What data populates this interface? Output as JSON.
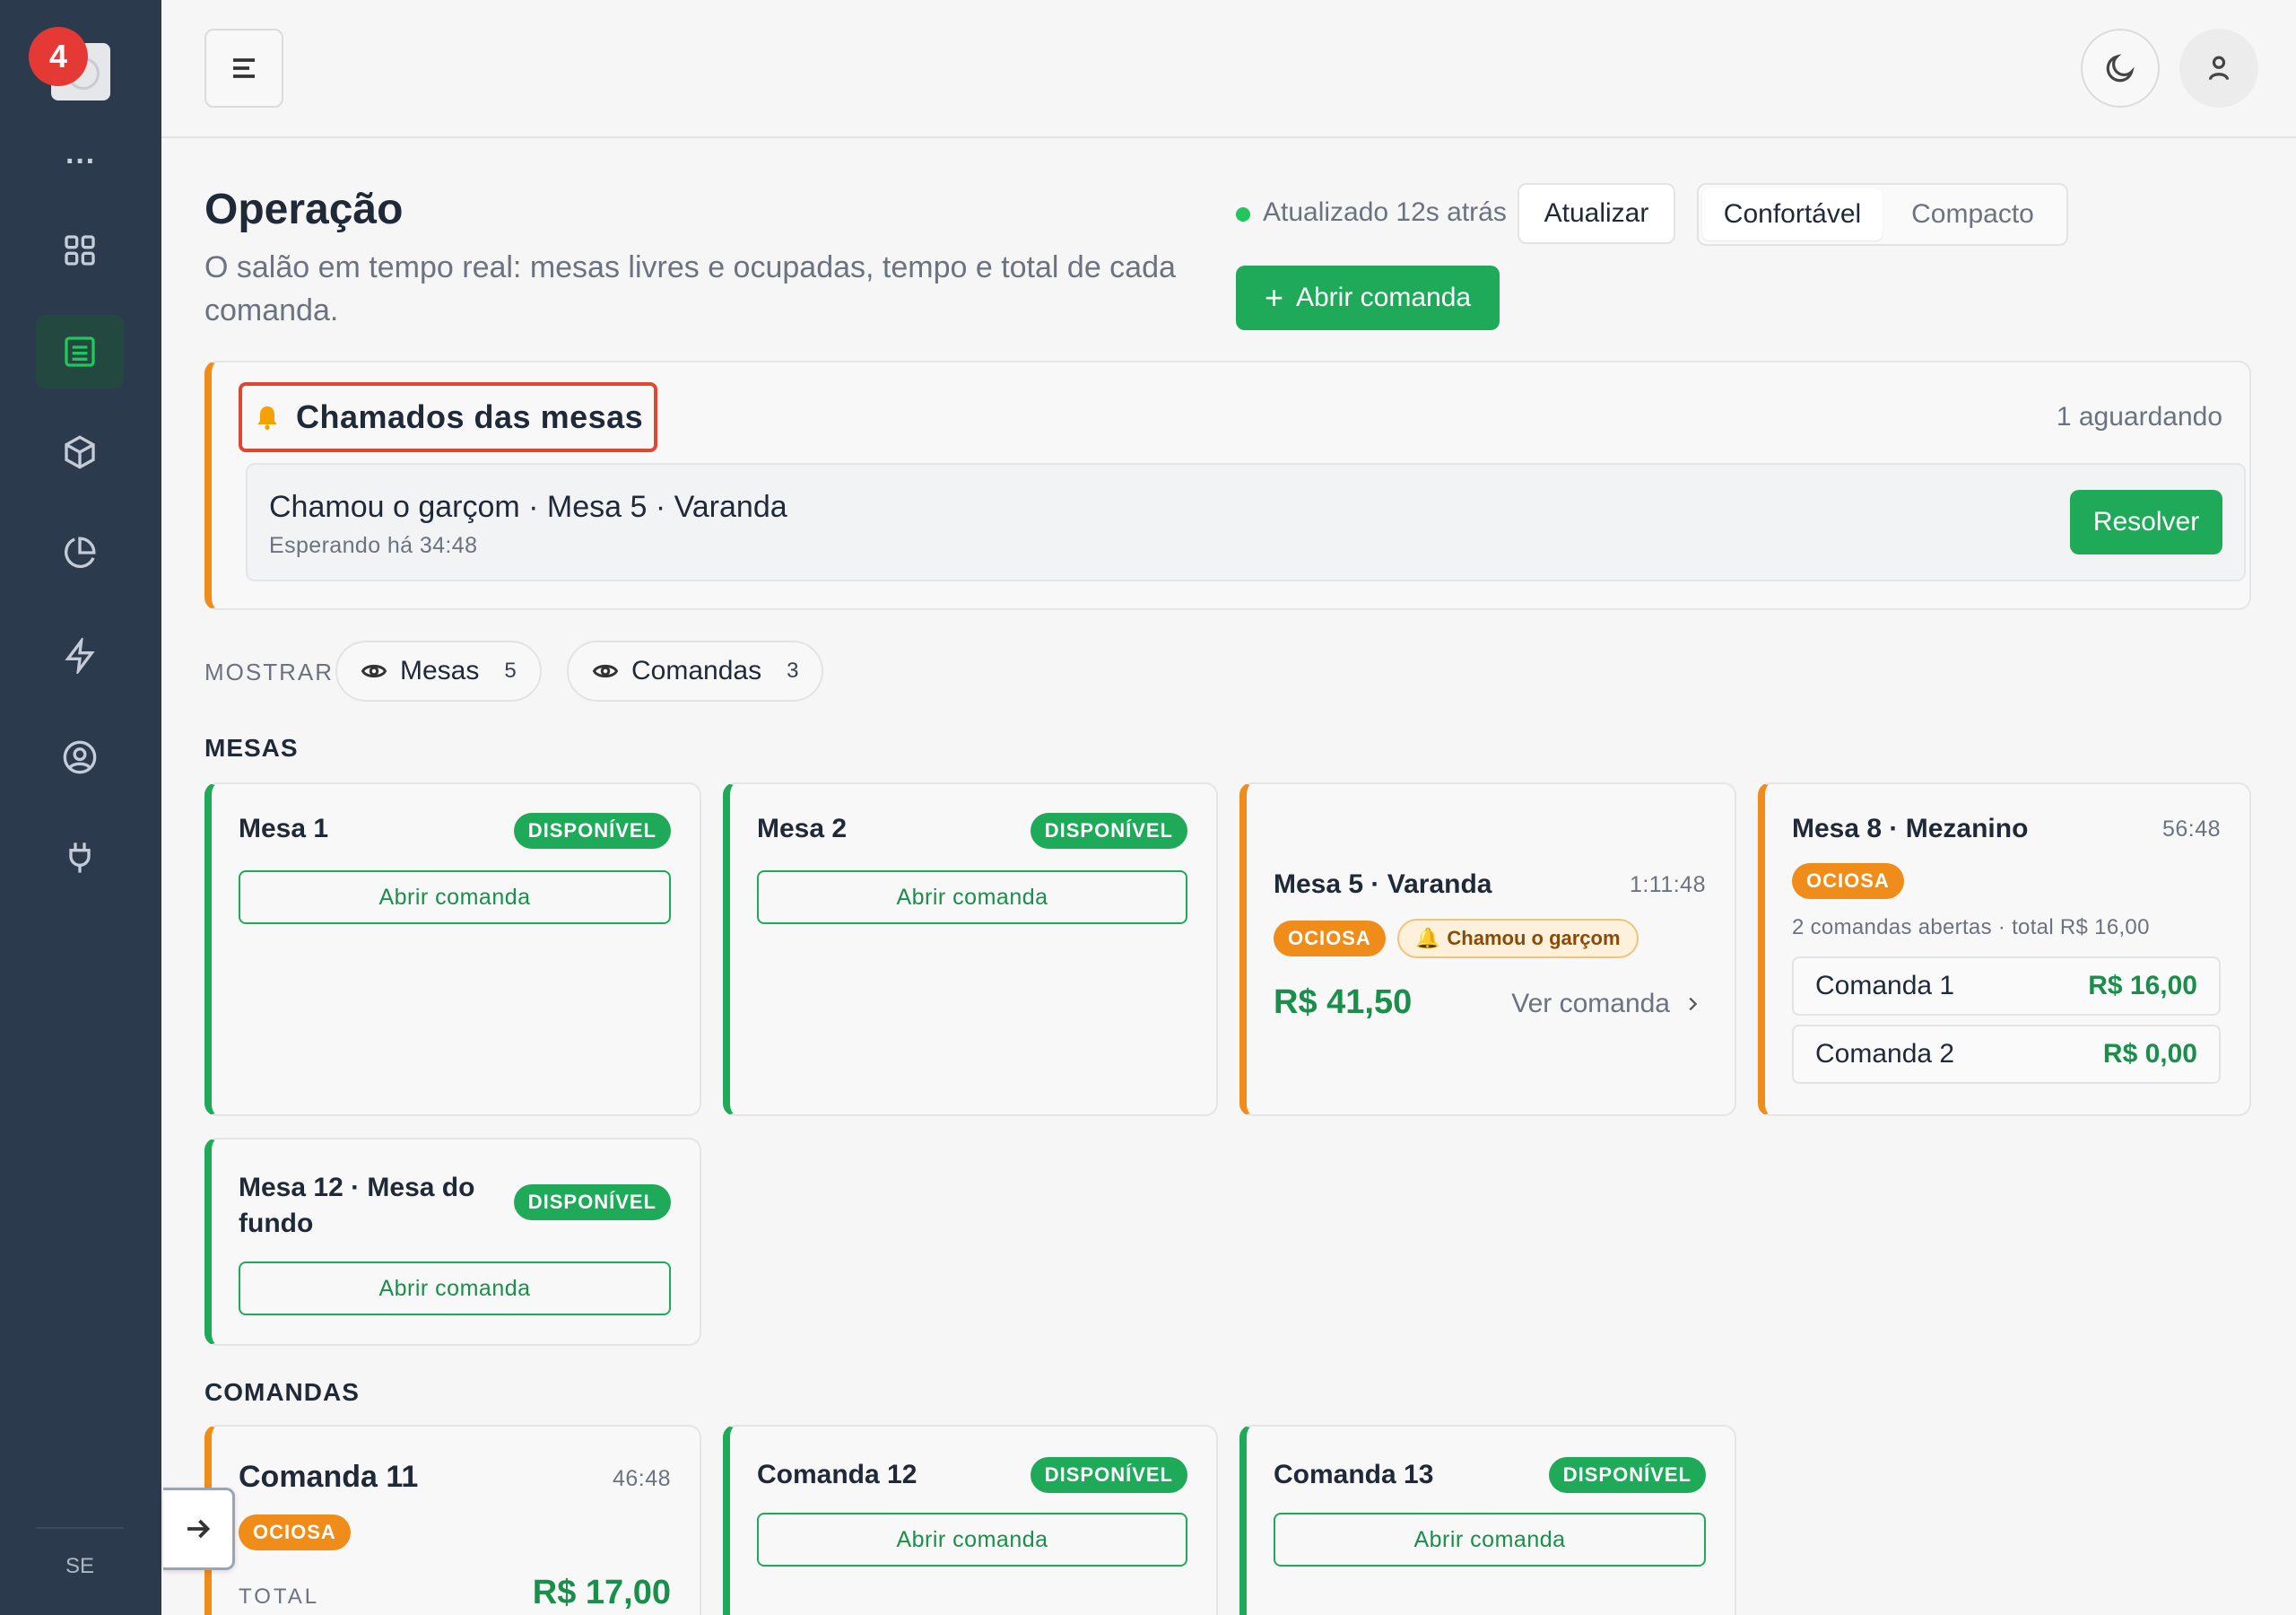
{
  "sidebar": {
    "notification_count": "4",
    "footer": "SE",
    "items": [
      {
        "name": "dashboard",
        "icon": "grid-icon"
      },
      {
        "name": "operations",
        "icon": "list-icon",
        "active": true
      },
      {
        "name": "products",
        "icon": "box-icon"
      },
      {
        "name": "reports",
        "icon": "pie-chart-icon"
      },
      {
        "name": "automations",
        "icon": "bolt-icon"
      },
      {
        "name": "users",
        "icon": "user-circle-icon"
      },
      {
        "name": "integrations",
        "icon": "plug-icon"
      }
    ]
  },
  "header": {
    "title": "Operação",
    "subtitle": "O salão em tempo real: mesas livres e ocupadas, tempo e total de cada comanda.",
    "status": "Atualizado 12s atrás",
    "refresh_label": "Atualizar",
    "density_options": [
      "Confortável",
      "Compacto"
    ],
    "density_selected": "Confortável",
    "open_order_label": "Abrir comanda"
  },
  "calls": {
    "title": "Chamados das mesas",
    "count": "1 aguardando",
    "items": [
      {
        "text": "Chamou o garçom · Mesa 5 · Varanda",
        "wait": "Esperando há 34:48",
        "action": "Resolver"
      }
    ]
  },
  "filters": {
    "label": "MOSTRAR",
    "chips": [
      {
        "label": "Mesas",
        "count": "5"
      },
      {
        "label": "Comandas",
        "count": "3"
      }
    ]
  },
  "tables_section": {
    "title": "MESAS",
    "cards": [
      {
        "name": "Mesa 1",
        "status": "DISPONÍVEL",
        "action": "Abrir comanda"
      },
      {
        "name": "Mesa 2",
        "status": "DISPONÍVEL",
        "action": "Abrir comanda"
      },
      {
        "name": "Mesa 5 · Varanda",
        "time": "1:11:48",
        "status": "OCIOSA",
        "call": "Chamou o garçom",
        "total": "R$ 41,50",
        "link": "Ver comanda"
      },
      {
        "name": "Mesa 8 · Mezanino",
        "time": "56:48",
        "status": "OCIOSA",
        "summary": "2 comandas abertas · total R$ 16,00",
        "orders": [
          {
            "name": "Comanda 1",
            "value": "R$ 16,00"
          },
          {
            "name": "Comanda 2",
            "value": "R$ 0,00"
          }
        ]
      },
      {
        "name": "Mesa 12 · Mesa do fundo",
        "status": "DISPONÍVEL",
        "action": "Abrir comanda"
      }
    ]
  },
  "orders_section": {
    "title": "COMANDAS",
    "cards": [
      {
        "name": "Comanda 11",
        "time": "46:48",
        "status": "OCIOSA",
        "total_label": "TOTAL",
        "total": "R$ 17,00"
      },
      {
        "name": "Comanda 12",
        "status": "DISPONÍVEL",
        "action": "Abrir comanda"
      },
      {
        "name": "Comanda 13",
        "status": "DISPONÍVEL",
        "action": "Abrir comanda"
      }
    ]
  },
  "colors": {
    "accent": "#1faa59",
    "warning": "#f08c1a",
    "alert": "#e2462f",
    "sidebar": "#2c3a4d"
  }
}
